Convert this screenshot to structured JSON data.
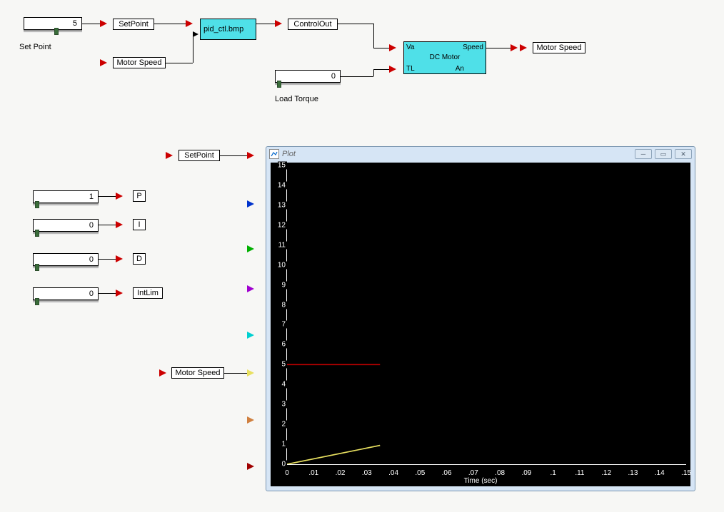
{
  "top_diagram": {
    "setpoint_value": "5",
    "setpoint_label": "Set Point",
    "setpoint_block": "SetPoint",
    "motor_speed_block": "Motor Speed",
    "pid_block": "pid_ctl.bmp",
    "control_out_block": "ControlOut",
    "load_torque_value": "0",
    "load_torque_label": "Load Torque",
    "dc_motor": {
      "title": "DC Motor",
      "va": "Va",
      "tl": "TL",
      "speed": "Speed",
      "an": "An"
    },
    "motor_speed_out": "Motor Speed"
  },
  "side_controls": {
    "setpoint_block": "SetPoint",
    "p_value": "1",
    "p_label": "P",
    "i_value": "0",
    "i_label": "I",
    "d_value": "0",
    "d_label": "D",
    "intlim_value": "0",
    "intlim_label": "IntLim",
    "motor_speed_block": "Motor Speed"
  },
  "plot_window": {
    "title": "Plot",
    "x_title": "Time (sec)",
    "y_ticks": [
      "15",
      "14",
      "13",
      "12",
      "11",
      "10",
      "9",
      "8",
      "7",
      "6",
      "5",
      "4",
      "3",
      "2",
      "1",
      "0"
    ],
    "x_ticks": [
      "0",
      ".01",
      ".02",
      ".03",
      ".04",
      ".05",
      ".06",
      ".07",
      ".08",
      ".09",
      ".1",
      ".11",
      ".12",
      ".13",
      ".14",
      ".15"
    ]
  },
  "chart_data": {
    "type": "line",
    "title": "Plot",
    "xlabel": "Time (sec)",
    "ylabel": "",
    "xlim": [
      0,
      0.15
    ],
    "ylim": [
      0,
      15
    ],
    "series": [
      {
        "name": "SetPoint",
        "color": "#c00000",
        "x": [
          0,
          0.035
        ],
        "y": [
          5,
          5
        ]
      },
      {
        "name": "Motor Speed",
        "color": "#e8e060",
        "x": [
          0,
          0.035
        ],
        "y": [
          0,
          0.9
        ]
      }
    ]
  }
}
